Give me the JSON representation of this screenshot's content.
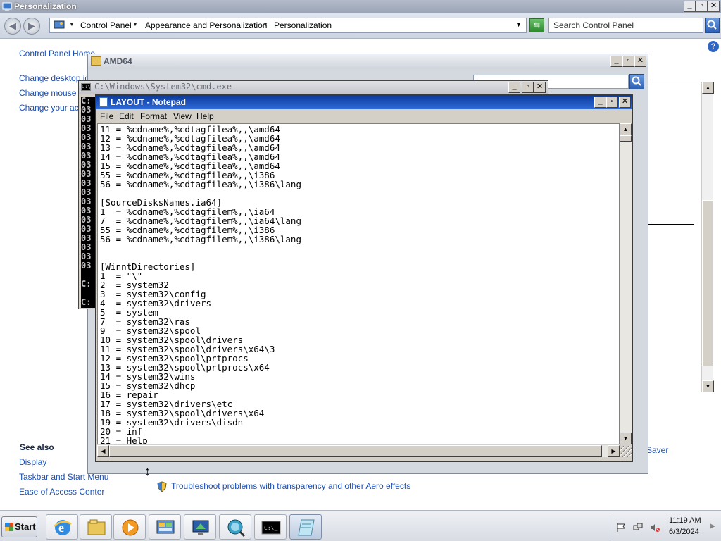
{
  "control_panel": {
    "title": "Personalization",
    "breadcrumbs": [
      "Control Panel",
      "Appearance and Personalization",
      "Personalization"
    ],
    "search_placeholder": "Search Control Panel",
    "left_links": {
      "home": "Control Panel Home",
      "desktop_icons": "Change desktop ic",
      "mouse_pointers": "Change mouse po",
      "account_picture": "Change your acc"
    },
    "see_also": {
      "heading": "See also",
      "display": "Display",
      "taskbar": "Taskbar and Start Menu",
      "ease": "Ease of Access Center"
    },
    "screen_saver_fragment": "Saver",
    "troubleshoot": "Troubleshoot problems with transparency and other Aero effects"
  },
  "explorer_window": {
    "title": "AMD64"
  },
  "cmd_window": {
    "title": "C:\\Windows\\System32\\cmd.exe",
    "lines": [
      "C:",
      "03",
      "03",
      "03",
      "03",
      "03",
      "03",
      "03",
      "03",
      "03",
      "03",
      "03",
      "03",
      "03",
      "03",
      "03",
      "03",
      "03",
      "03",
      "",
      "C:",
      "",
      "C:"
    ]
  },
  "notepad": {
    "title": "LAYOUT - Notepad",
    "menu": {
      "file": "File",
      "edit": "Edit",
      "format": "Format",
      "view": "View",
      "help": "Help"
    },
    "content": "11 = %cdname%,%cdtagfilea%,,\\amd64\n12 = %cdname%,%cdtagfilea%,,\\amd64\n13 = %cdname%,%cdtagfilea%,,\\amd64\n14 = %cdname%,%cdtagfilea%,,\\amd64\n15 = %cdname%,%cdtagfilea%,,\\amd64\n55 = %cdname%,%cdtagfilea%,,\\i386\n56 = %cdname%,%cdtagfilea%,,\\i386\\lang\n\n[SourceDisksNames.ia64]\n1  = %cdname%,%cdtagfilem%,,\\ia64\n7  = %cdname%,%cdtagfilem%,,\\ia64\\lang\n55 = %cdname%,%cdtagfilem%,,\\i386\n56 = %cdname%,%cdtagfilem%,,\\i386\\lang\n\n\n[WinntDirectories]\n1  = \"\\\"\n2  = system32\n3  = system32\\config\n4  = system32\\drivers\n5  = system\n7  = system32\\ras\n9  = system32\\spool\n10 = system32\\spool\\drivers\n11 = system32\\spool\\drivers\\x64\\3\n12 = system32\\spool\\prtprocs\n13 = system32\\spool\\prtprocs\\x64\n14 = system32\\wins\n15 = system32\\dhcp\n16 = repair\n17 = system32\\drivers\\etc\n18 = system32\\spool\\drivers\\x64\n19 = system32\\drivers\\disdn\n20 = inf\n21 = Help"
  },
  "taskbar": {
    "start_label": "Start",
    "apps": [
      "internet-explorer",
      "windows-explorer",
      "media-player",
      "control-panel",
      "remote-desktop",
      "search-browser",
      "command-prompt",
      "notepad"
    ],
    "clock_time": "11:19 AM",
    "clock_date": "6/3/2024"
  }
}
